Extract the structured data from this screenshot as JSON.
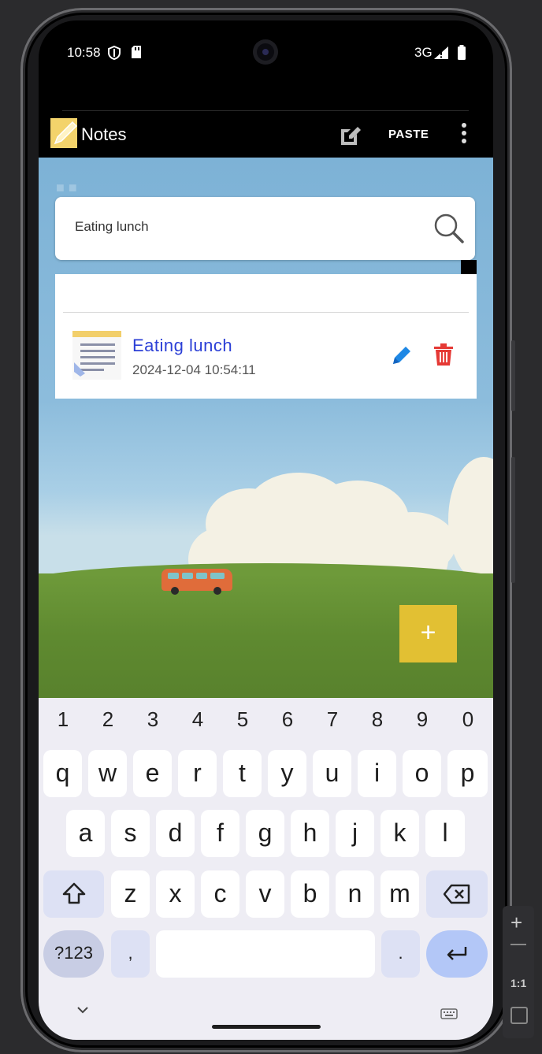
{
  "status_bar": {
    "time": "10:58",
    "network": "3G"
  },
  "action_bar": {
    "title": "Notes",
    "paste_label": "PASTE"
  },
  "search": {
    "value": "Eating lunch"
  },
  "notes": [
    {
      "title": "Eating  lunch",
      "date": "2024-12-04 10:54:11"
    }
  ],
  "fab": {
    "label": "+"
  },
  "keyboard": {
    "numbers": [
      "1",
      "2",
      "3",
      "4",
      "5",
      "6",
      "7",
      "8",
      "9",
      "0"
    ],
    "row1": [
      "q",
      "w",
      "e",
      "r",
      "t",
      "y",
      "u",
      "i",
      "o",
      "p"
    ],
    "row2": [
      "a",
      "s",
      "d",
      "f",
      "g",
      "h",
      "j",
      "k",
      "l"
    ],
    "row3": [
      "z",
      "x",
      "c",
      "v",
      "b",
      "n",
      "m"
    ],
    "symbols_label": "?123",
    "comma": ",",
    "period": "."
  },
  "emulator": {
    "zoom_plus": "+",
    "ratio": "1:1"
  },
  "colors": {
    "accent": "#2b3fd6",
    "fab": "#e2c033",
    "delete": "#e53935",
    "edit": "#1e88e5"
  }
}
